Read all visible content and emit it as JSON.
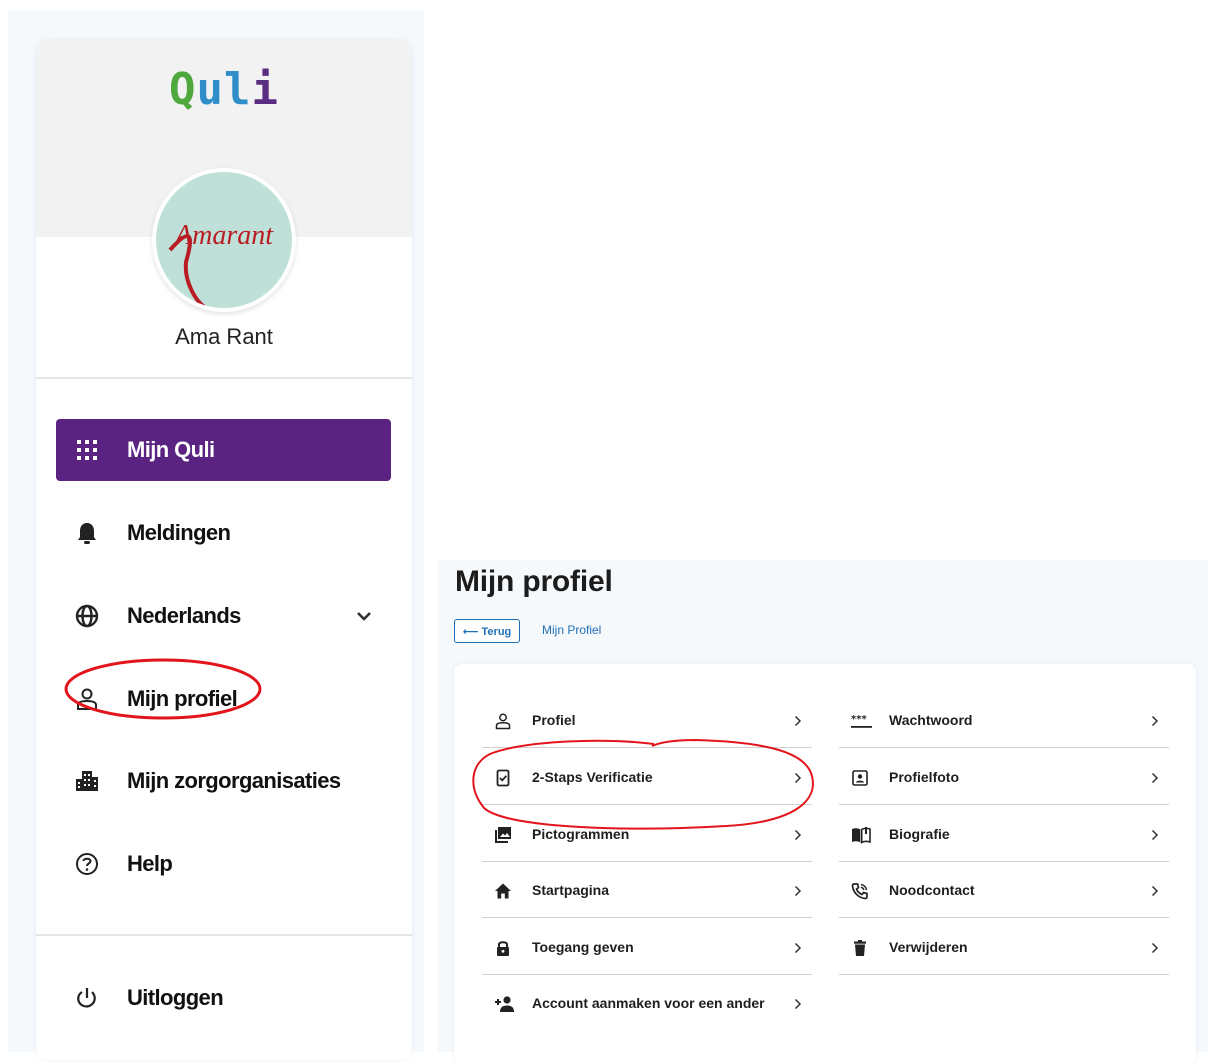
{
  "sidebar": {
    "logo_text": "Quli",
    "logo_colors": {
      "q": "#4fa83d",
      "ul": "#2f8ec9",
      "i": "#5a2d82"
    },
    "avatar_text": "Amarant",
    "user_name": "Ama Rant",
    "nav": [
      {
        "label": "Mijn Quli",
        "icon": "grid-icon",
        "active": true
      },
      {
        "label": "Meldingen",
        "icon": "bell-icon"
      },
      {
        "label": "Nederlands",
        "icon": "globe-icon",
        "dropdown": true
      },
      {
        "label": "Mijn profiel",
        "icon": "person-icon"
      },
      {
        "label": "Mijn zorgorganisaties",
        "icon": "buildings-icon"
      },
      {
        "label": "Help",
        "icon": "help-icon"
      }
    ],
    "logout_label": "Uitloggen",
    "active_color": "#5a2381"
  },
  "profile": {
    "title": "Mijn profiel",
    "back_label": "⟵ Terug",
    "breadcrumb": "Mijn Profiel",
    "left_items": [
      {
        "label": "Profiel",
        "icon": "person-icon"
      },
      {
        "label": "2-Staps Verificatie",
        "icon": "verify-icon"
      },
      {
        "label": "Pictogrammen",
        "icon": "images-icon"
      },
      {
        "label": "Startpagina",
        "icon": "home-icon"
      },
      {
        "label": "Toegang geven",
        "icon": "lock-icon"
      },
      {
        "label": "Account aanmaken voor een ander",
        "icon": "add-person-icon"
      }
    ],
    "right_items": [
      {
        "label": "Wachtwoord",
        "icon": "password-icon"
      },
      {
        "label": "Profielfoto",
        "icon": "portrait-icon"
      },
      {
        "label": "Biografie",
        "icon": "book-icon"
      },
      {
        "label": "Noodcontact",
        "icon": "phone-icon"
      },
      {
        "label": "Verwijderen",
        "icon": "trash-icon"
      }
    ],
    "link_color": "#1f6fb5"
  },
  "annotation_color": "#e3141b"
}
